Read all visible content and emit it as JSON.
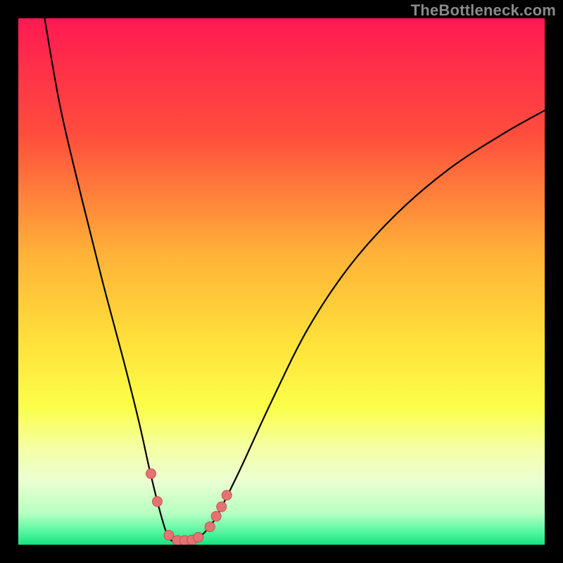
{
  "watermark": "TheBottleneck.com",
  "chart_data": {
    "type": "line",
    "title": "",
    "xlabel": "",
    "ylabel": "",
    "xlim": [
      0,
      100
    ],
    "ylim": [
      0,
      100
    ],
    "grid": false,
    "legend": false,
    "gradient_stops": [
      {
        "offset": 0.0,
        "color": "#ff1a52"
      },
      {
        "offset": 0.22,
        "color": "#ff4d3d"
      },
      {
        "offset": 0.45,
        "color": "#ffb338"
      },
      {
        "offset": 0.62,
        "color": "#ffe23a"
      },
      {
        "offset": 0.74,
        "color": "#fbff4a"
      },
      {
        "offset": 0.82,
        "color": "#f4ffa8"
      },
      {
        "offset": 0.88,
        "color": "#eaffd2"
      },
      {
        "offset": 0.94,
        "color": "#b8ffc2"
      },
      {
        "offset": 0.975,
        "color": "#55f7a0"
      },
      {
        "offset": 1.0,
        "color": "#16e37f"
      }
    ],
    "series": [
      {
        "name": "bottleneck-curve",
        "x": [
          5,
          8,
          12,
          16,
          20,
          23,
          25,
          27,
          28.5,
          30,
          32,
          34,
          36,
          38,
          42,
          48,
          55,
          63,
          72,
          82,
          92,
          100
        ],
        "y": [
          100,
          83,
          66,
          50,
          35,
          23,
          14,
          6,
          1.5,
          0.5,
          0.5,
          1.2,
          3,
          6,
          14,
          27,
          41,
          53,
          63,
          71.5,
          78,
          82.5
        ]
      }
    ],
    "markers": [
      {
        "x": 25.2,
        "y": 13.5
      },
      {
        "x": 26.4,
        "y": 8.2
      },
      {
        "x": 28.6,
        "y": 1.8
      },
      {
        "x": 30.2,
        "y": 0.8
      },
      {
        "x": 31.6,
        "y": 0.8
      },
      {
        "x": 33.0,
        "y": 0.9
      },
      {
        "x": 34.2,
        "y": 1.4
      },
      {
        "x": 36.4,
        "y": 3.4
      },
      {
        "x": 37.6,
        "y": 5.4
      },
      {
        "x": 38.6,
        "y": 7.2
      },
      {
        "x": 39.6,
        "y": 9.4
      }
    ],
    "marker_style": {
      "r": 7,
      "fill": "#e57373",
      "stroke": "#c94f4f"
    }
  }
}
